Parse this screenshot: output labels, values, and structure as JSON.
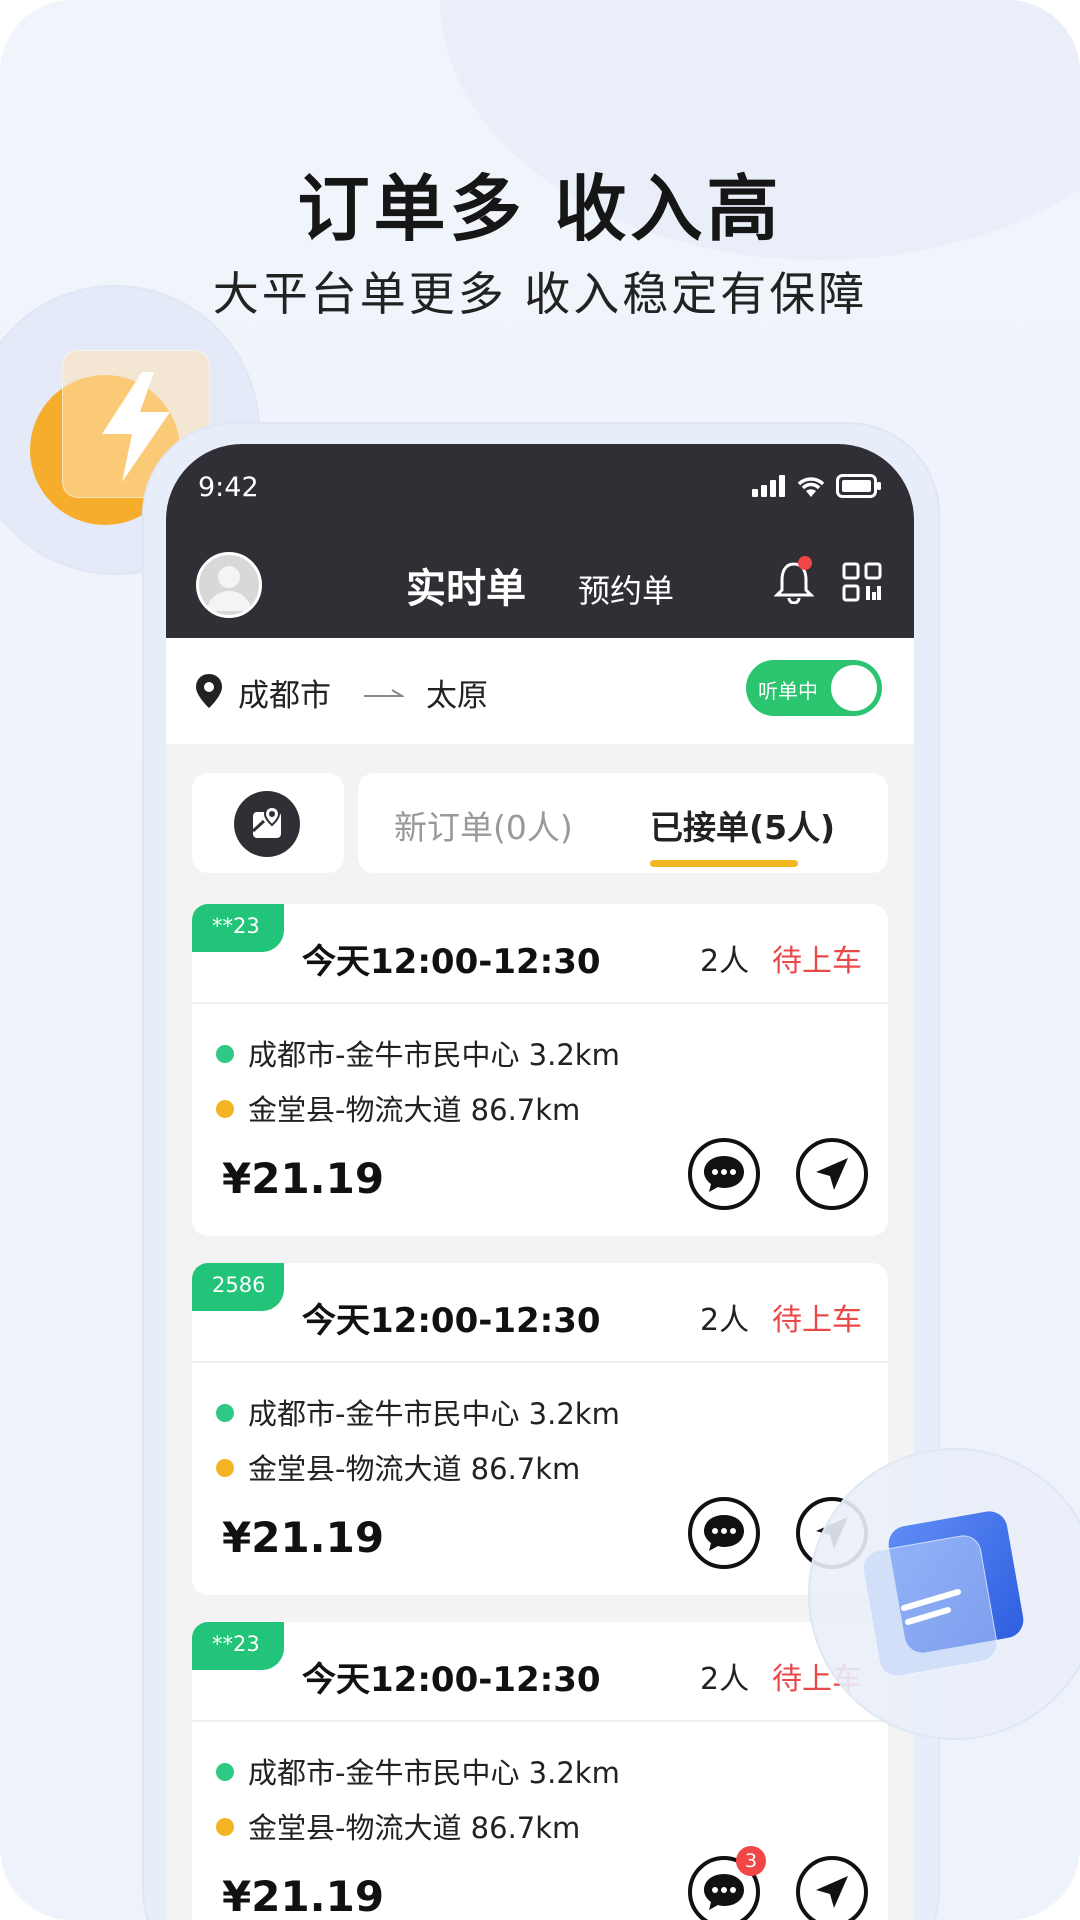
{
  "promo": {
    "headline": "订单多 收入高",
    "subline": "大平台单更多 收入稳定有保障"
  },
  "status_bar": {
    "time": "9:42"
  },
  "header": {
    "tab_realtime": "实时单",
    "tab_reserved": "预约单"
  },
  "route": {
    "from": "成都市",
    "to": "太原",
    "listen_label": "听单中",
    "listen_on": true
  },
  "order_tabs": {
    "new": "新订单(0人)",
    "accepted": "已接单(5人)",
    "active": "accepted"
  },
  "orders": [
    {
      "badge": "**23",
      "time": "今天12:00-12:30",
      "people": "2人",
      "status": "待上车",
      "pickup": "成都市-金牛市民中心 3.2km",
      "dropoff": "金堂县-物流大道  86.7km",
      "price": "¥21.19",
      "unread": null
    },
    {
      "badge": "2586",
      "time": "今天12:00-12:30",
      "people": "2人",
      "status": "待上车",
      "pickup": "成都市-金牛市民中心 3.2km",
      "dropoff": "金堂县-物流大道  86.7km",
      "price": "¥21.19",
      "unread": null
    },
    {
      "badge": "**23",
      "time": "今天12:00-12:30",
      "people": "2人",
      "status": "待上车",
      "pickup": "成都市-金牛市民中心 3.2km",
      "dropoff": "金堂县-物流大道  86.7km",
      "price": "¥21.19",
      "unread": "3"
    }
  ],
  "colors": {
    "topbar": "#2f2f35",
    "accent_green": "#22c47a",
    "status_red": "#e84a4a",
    "tab_underline": "#f3b623",
    "bolt_orange": "#f6ad2b",
    "doc_blue": "#2f5ee0"
  },
  "icons": [
    "lightning-bolt-icon",
    "signal-icon",
    "wifi-icon",
    "battery-icon",
    "avatar-icon",
    "bell-icon",
    "qr-code-icon",
    "location-pin-icon",
    "arrow-right-icon",
    "map-pin-icon",
    "chat-icon",
    "navigation-arrow-icon",
    "document-icon"
  ]
}
